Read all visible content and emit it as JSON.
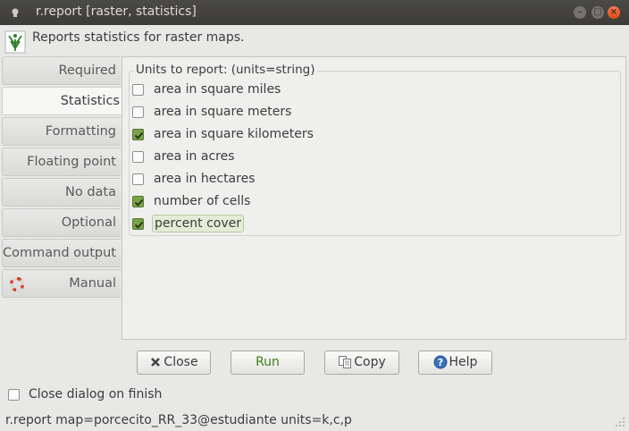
{
  "window": {
    "title": "r.report [raster, statistics]",
    "minimize_label": "–",
    "maximize_label": "□",
    "close_label": "×"
  },
  "description": "Reports statistics for raster maps.",
  "tabs": [
    {
      "label": "Required"
    },
    {
      "label": "Statistics"
    },
    {
      "label": "Formatting"
    },
    {
      "label": "Floating point"
    },
    {
      "label": "No data"
    },
    {
      "label": "Optional"
    },
    {
      "label": "Command output"
    },
    {
      "label": "Manual"
    }
  ],
  "active_tab": "Statistics",
  "units_group": {
    "title": "Units to report:  (units=string)",
    "options": [
      {
        "label": "area in square miles",
        "checked": false
      },
      {
        "label": "area in square meters",
        "checked": false
      },
      {
        "label": "area in square kilometers",
        "checked": true
      },
      {
        "label": "area in acres",
        "checked": false
      },
      {
        "label": "area in hectares",
        "checked": false
      },
      {
        "label": "number of cells",
        "checked": true
      },
      {
        "label": "percent cover",
        "checked": true
      }
    ]
  },
  "buttons": {
    "close": "Close",
    "run": "Run",
    "copy": "Copy",
    "help": "Help"
  },
  "close_on_finish": {
    "label": "Close dialog on finish",
    "checked": false
  },
  "status_command": "r.report map=porcecito_RR_33@estudiante units=k,c,p",
  "colors": {
    "titlebar": "#3c3b37",
    "check_green": "#79a24a",
    "run_green": "#3d7f14",
    "close_orange": "#df4a16"
  }
}
